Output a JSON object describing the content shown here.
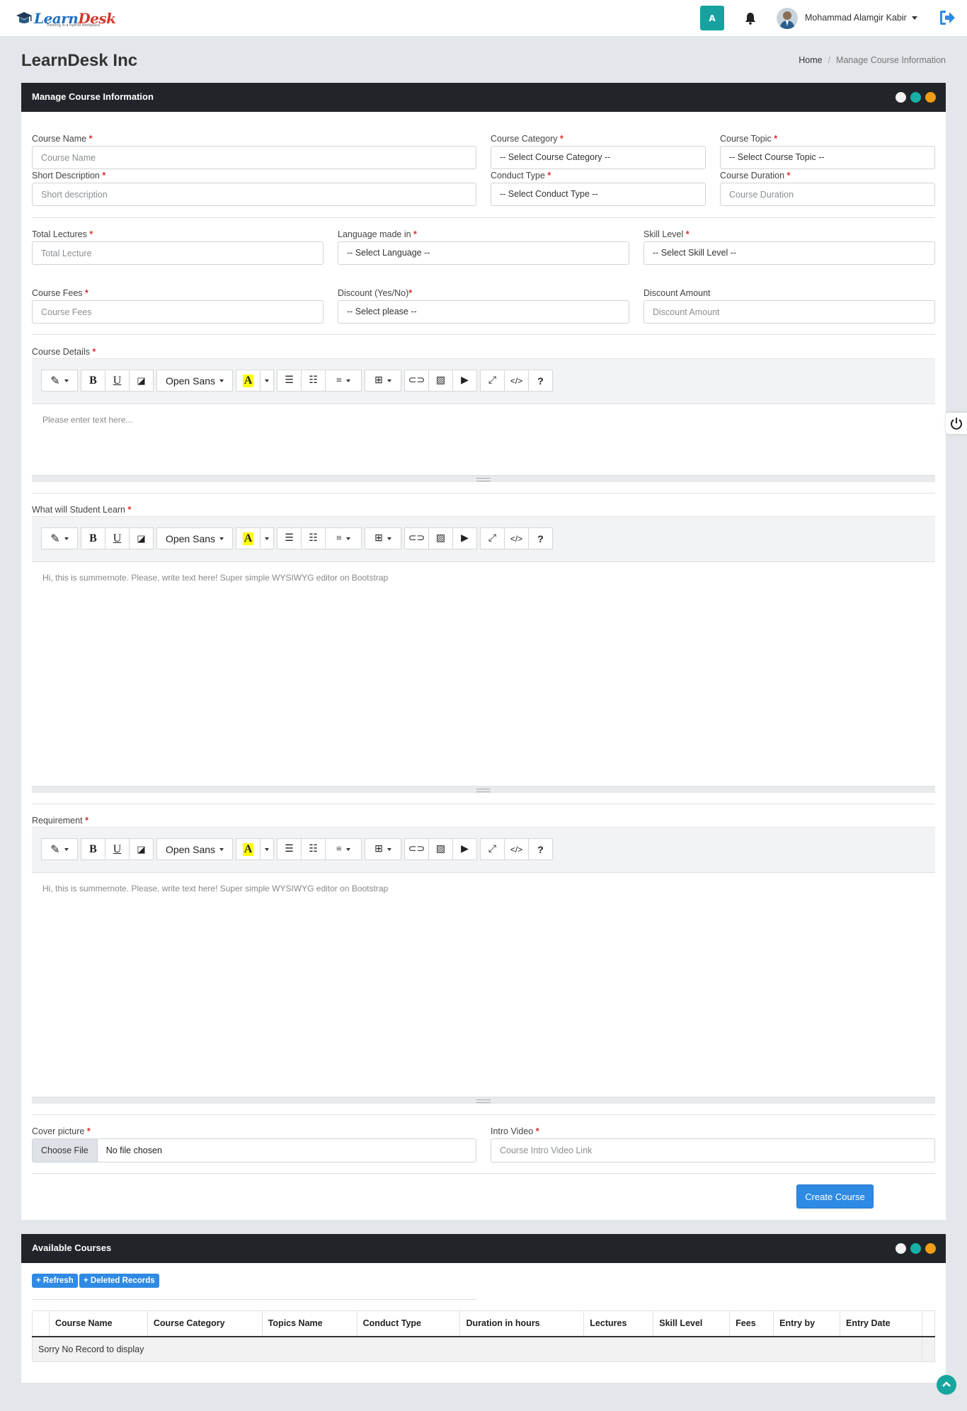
{
  "topbar": {
    "logo_text_a": "Learn",
    "logo_text_b": "Desk",
    "logo_tagline": "Training in a hybrid workplace",
    "avatar_letter": "A",
    "user_name": "Mohammad Alamgir Kabir"
  },
  "page": {
    "title": "LearnDesk Inc",
    "breadcrumb": [
      "Home",
      "Manage Course Information"
    ]
  },
  "form_card": {
    "title": "Manage Course Information",
    "fields": {
      "course_name": {
        "label": "Course Name",
        "placeholder": "Course Name"
      },
      "course_category": {
        "label": "Course Category",
        "value": "-- Select Course Category --"
      },
      "course_topic": {
        "label": "Course Topic",
        "value": "-- Select Course Topic --"
      },
      "short_description": {
        "label": "Short Description",
        "placeholder": "Short description"
      },
      "conduct_type": {
        "label": "Conduct Type",
        "value": "-- Select Conduct Type --"
      },
      "course_duration": {
        "label": "Course Duration",
        "placeholder": "Course Duration"
      },
      "total_lectures": {
        "label": "Total Lectures",
        "placeholder": "Total Lecture"
      },
      "language": {
        "label": "Language made in",
        "value": "-- Select Language --"
      },
      "skill_level": {
        "label": "Skill Level",
        "value": "-- Select Skill Level --"
      },
      "course_fees": {
        "label": "Course Fees",
        "placeholder": "Course Fees"
      },
      "discount": {
        "label": "Discount (Yes/No)",
        "value": "-- Select please --"
      },
      "discount_amount": {
        "label": "Discount Amount",
        "placeholder": "Discount Amount"
      },
      "cover_picture": {
        "label": "Cover picture",
        "button": "Choose File",
        "status": "No file chosen"
      },
      "intro_video": {
        "label": "Intro Video",
        "placeholder": "Course Intro Video Link"
      }
    },
    "required_mark": "*",
    "editors": {
      "course_details": {
        "label": "Course Details",
        "placeholder": "Please enter text here..."
      },
      "student_learn": {
        "label": "What will Student Learn",
        "placeholder": "Hi, this is summernote. Please, write text here! Super simple WYSIWYG editor on Bootstrap"
      },
      "requirement": {
        "label": "Requirement",
        "placeholder": "Hi, this is summernote. Please, write text here! Super simple WYSIWYG editor on Bootstrap"
      }
    },
    "toolbar": {
      "bold": "B",
      "underline": "U",
      "font": "Open Sans",
      "color": "A",
      "code": "</>",
      "help": "?"
    },
    "create_button": "Create Course"
  },
  "courses_card": {
    "title": "Available Courses",
    "refresh_button": "+ Refresh",
    "deleted_button": "+ Deleted Records",
    "columns": [
      "Course Name",
      "Course Category",
      "Topics Name",
      "Conduct Type",
      "Duration in hours",
      "Lectures",
      "Skill Level",
      "Fees",
      "Entry by",
      "Entry Date"
    ],
    "empty_message": "Sorry No Record to display"
  },
  "colors": {
    "header_dark": "#212529",
    "accent_blue": "#2f8ae4",
    "teal": "#16b0a7",
    "orange": "#f29c13",
    "required_red": "#e02b2b"
  }
}
